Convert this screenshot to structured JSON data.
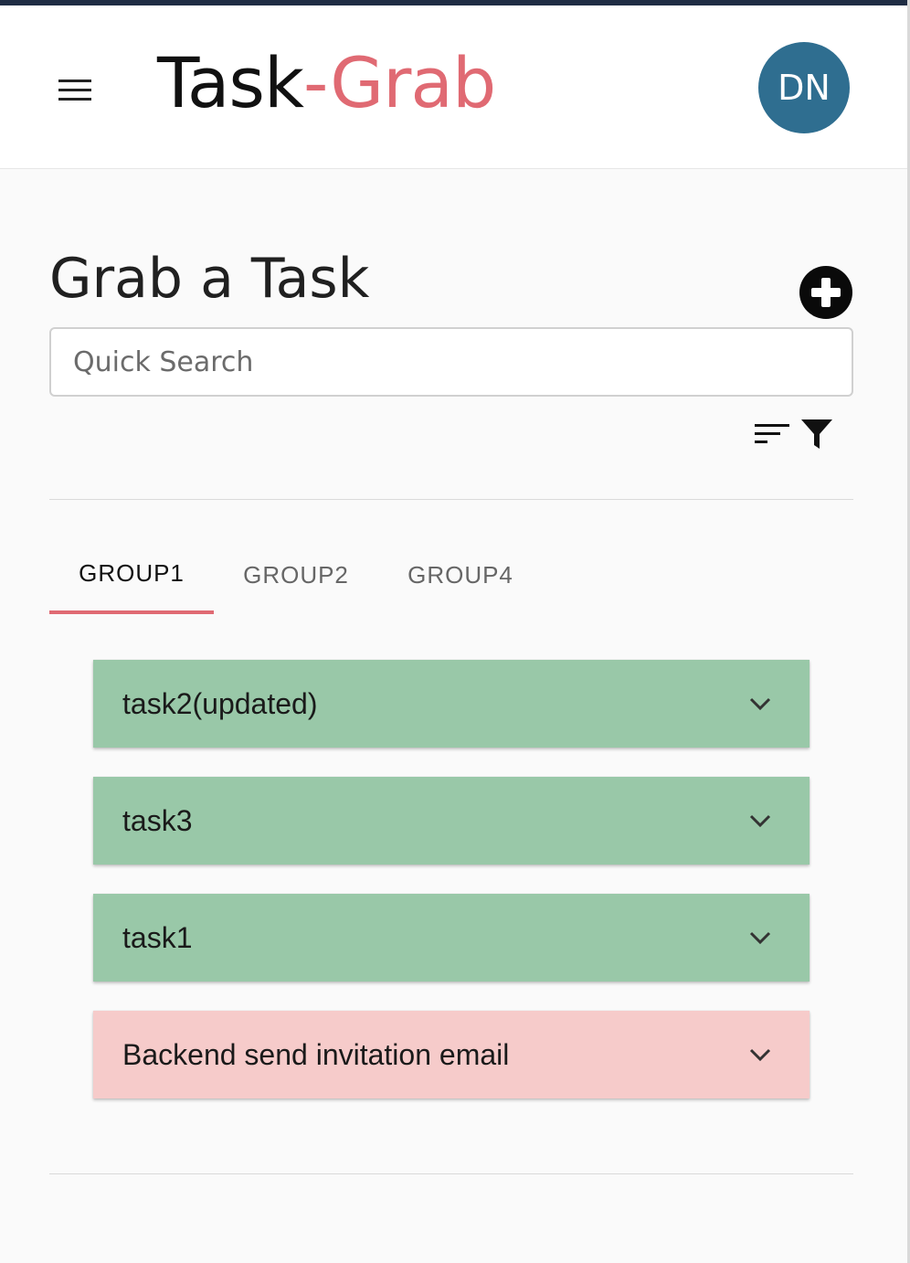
{
  "app": {
    "logo_main": "Task",
    "logo_accent": "-Grab",
    "user_initials": "DN",
    "accent_color": "#e06a73",
    "avatar_color": "#2f6e90"
  },
  "page": {
    "title": "Grab a Task",
    "add_icon": "plus-circle-icon"
  },
  "search": {
    "placeholder": "Quick Search",
    "value": ""
  },
  "toolbar": {
    "sort_icon": "sort-icon",
    "filter_icon": "filter-icon"
  },
  "tabs": [
    {
      "label": "GROUP1",
      "active": true
    },
    {
      "label": "GROUP2",
      "active": false
    },
    {
      "label": "GROUP4",
      "active": false
    }
  ],
  "tasks": [
    {
      "title": "task2(updated)",
      "color": "#99c8a8",
      "icon": "chevron-down-icon"
    },
    {
      "title": "task3",
      "color": "#99c8a8",
      "icon": "chevron-down-icon"
    },
    {
      "title": "task1",
      "color": "#99c8a8",
      "icon": "chevron-down-icon"
    },
    {
      "title": "Backend send invitation email",
      "color": "#f6cbca",
      "icon": "chevron-down-icon"
    }
  ]
}
